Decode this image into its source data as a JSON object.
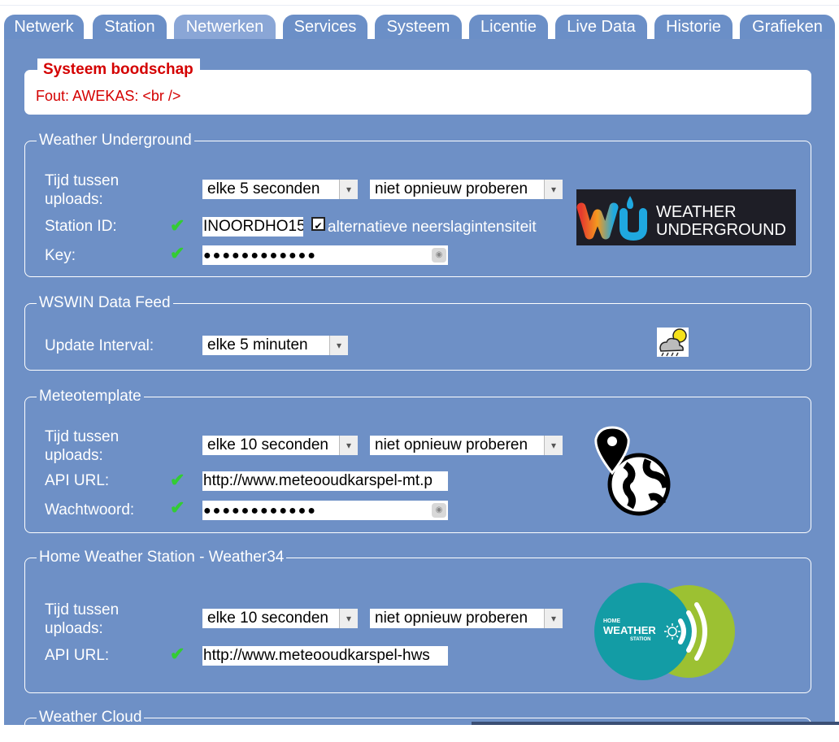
{
  "tabs": [
    {
      "label": "Netwerk",
      "active": false
    },
    {
      "label": "Station",
      "active": false
    },
    {
      "label": "Netwerken",
      "active": true
    },
    {
      "label": "Services",
      "active": false
    },
    {
      "label": "Systeem",
      "active": false
    },
    {
      "label": "Licentie",
      "active": false
    },
    {
      "label": "Live Data",
      "active": false
    },
    {
      "label": "Historie",
      "active": false
    },
    {
      "label": "Grafieken",
      "active": false
    }
  ],
  "system_message": {
    "title": "Systeem boodschap",
    "text": "Fout: AWEKAS: <br />"
  },
  "wunderground": {
    "legend": "Weather Underground",
    "upload_label": "Tijd tussen uploads:",
    "interval": "elke 5 seconden",
    "retry": "niet opnieuw proberen",
    "station_id_label": "Station ID:",
    "station_id": "INOORDHO15",
    "alt_rain_label": "alternatieve neerslagintensiteit",
    "alt_rain_checked": true,
    "key_label": "Key:",
    "key_mask": "●●●●●●●●●●●●",
    "logo_text_1": "WEATHER",
    "logo_text_2": "UNDERGROUND"
  },
  "wswin": {
    "legend": "WSWIN Data Feed",
    "interval_label": "Update Interval:",
    "interval": "elke 5 minuten"
  },
  "meteotemplate": {
    "legend": "Meteotemplate",
    "upload_label": "Tijd tussen uploads:",
    "interval": "elke 10 seconden",
    "retry": "niet opnieuw proberen",
    "api_label": "API URL:",
    "api_url": "http://www.meteooudkarspel-mt.p",
    "password_label": "Wachtwoord:",
    "password_mask": "●●●●●●●●●●●●"
  },
  "hws": {
    "legend": "Home Weather Station - Weather34",
    "upload_label": "Tijd tussen uploads:",
    "interval": "elke 10 seconden",
    "retry": "niet opnieuw proberen",
    "api_label": "API URL:",
    "api_url": "http://www.meteooudkarspel-hws",
    "logo_text_1": "HOME",
    "logo_text_2": "WEATHER",
    "logo_text_3": "STATION"
  },
  "weathercloud": {
    "legend": "Weather Cloud"
  },
  "icons": {
    "check": "✔",
    "dropdown": "▾",
    "eye": "◉"
  },
  "colors": {
    "panel": "#6e90c6",
    "tab": "#6b8fc7",
    "tab_active": "#8aa6d6",
    "error": "#d40000",
    "check": "#33cc33"
  }
}
